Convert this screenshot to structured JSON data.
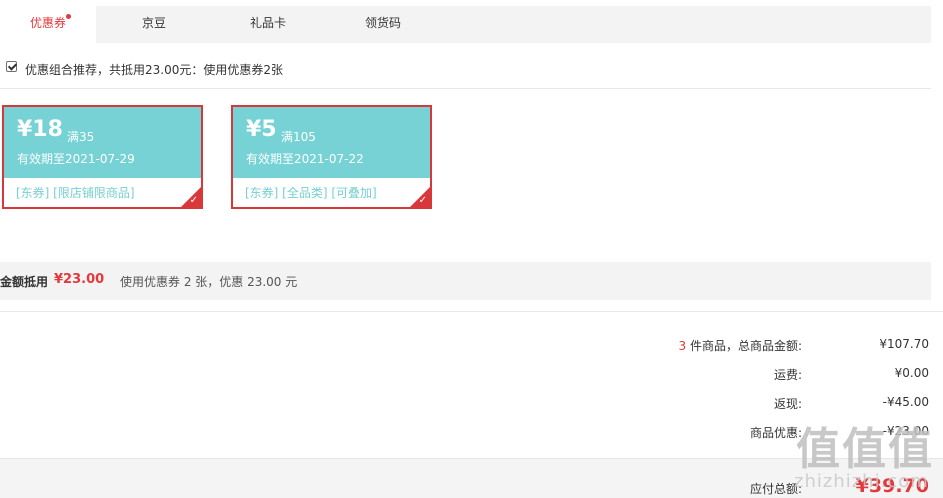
{
  "tabs": [
    {
      "label": "优惠券",
      "active": true
    },
    {
      "label": "京豆",
      "active": false
    },
    {
      "label": "礼品卡",
      "active": false
    },
    {
      "label": "领货码",
      "active": false
    }
  ],
  "combo": {
    "checked": true,
    "text": "优惠组合推荐，共抵用23.00元：使用优惠券2张"
  },
  "coupons": [
    {
      "amount": "¥18",
      "condition": "满35",
      "valid": "有效期至2021-07-29",
      "tags": "[东券]  [限店铺限商品]",
      "selected": true
    },
    {
      "amount": "¥5",
      "condition": "满105",
      "valid": "有效期至2021-07-22",
      "tags": "[东券]  [全品类]  [可叠加]",
      "selected": true
    }
  ],
  "discount": {
    "label": "金额抵用",
    "value": "¥23.00",
    "desc": "使用优惠券 2 张，优惠 23.00 元"
  },
  "summary": {
    "count": "3",
    "items_label": " 件商品，总商品金额:",
    "items_value": "¥107.70",
    "shipping_label": "运费:",
    "shipping_value": "¥0.00",
    "cashback_label": "返现:",
    "cashback_value": "-¥45.00",
    "promo_label": "商品优惠:",
    "promo_value": "-¥23.00",
    "total_label": "应付总额:",
    "total_value": "¥39.70"
  },
  "watermark": {
    "text": "zhizhizhi.com",
    "logo": "值值值"
  },
  "colors": {
    "accent": "#e4393c",
    "coupon_bg": "#76d2d4"
  }
}
